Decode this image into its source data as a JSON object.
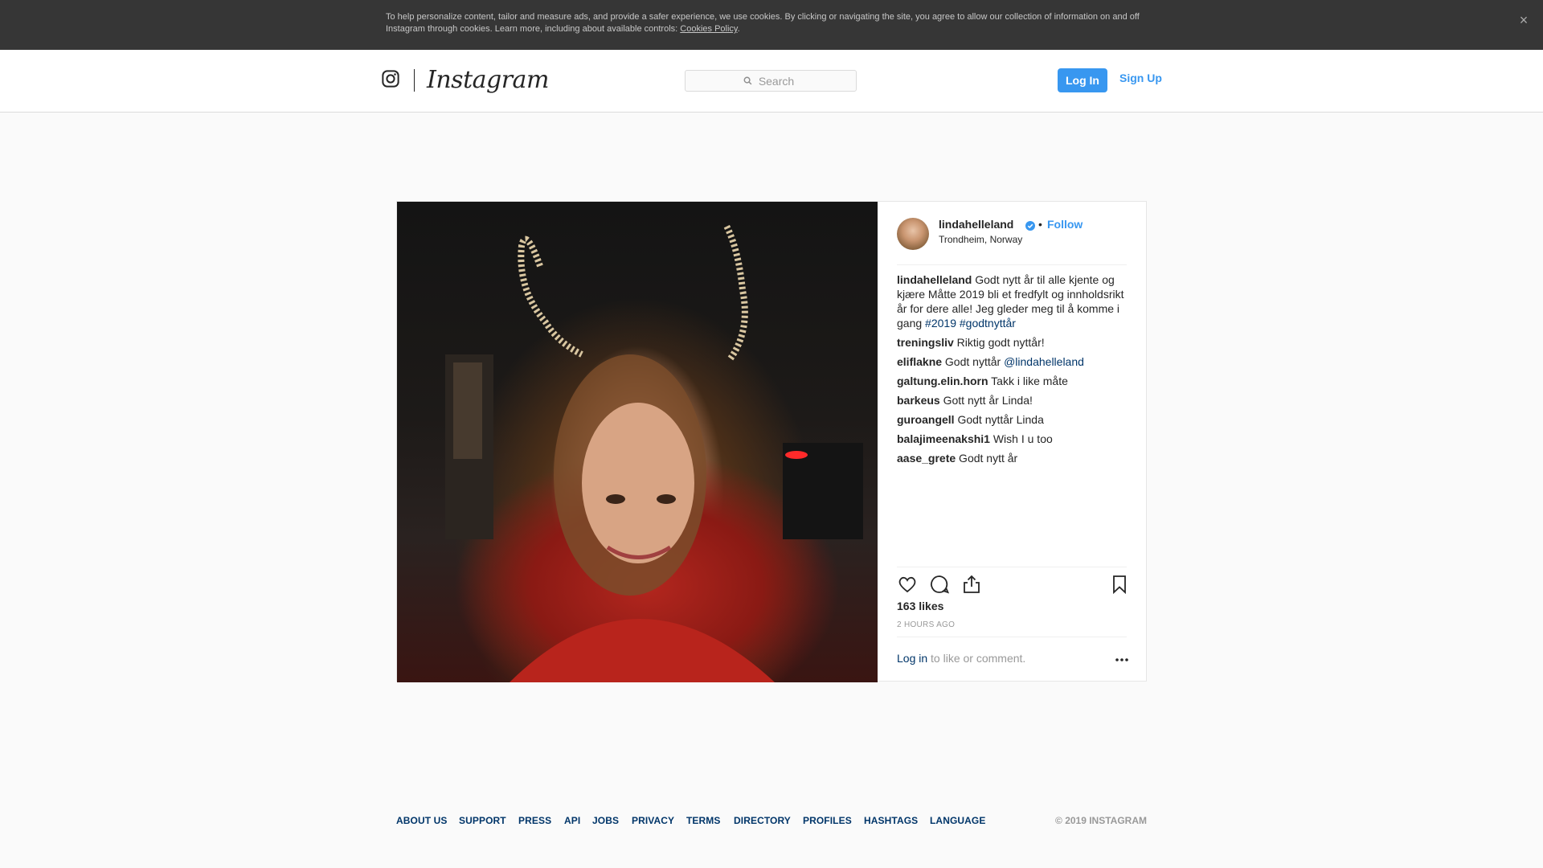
{
  "cookie_banner": {
    "text": "To help personalize content, tailor and measure ads, and provide a safer experience, we use cookies. By clicking or navigating the site, you agree to allow our collection of information on and off Instagram through cookies. Learn more, including about available controls: ",
    "link": "Cookies Policy",
    "trailing": ".",
    "close": "×"
  },
  "header": {
    "logo": "Instagram",
    "search_placeholder": "Search",
    "login": "Log In",
    "signup": "Sign Up"
  },
  "post": {
    "username": "lindahelleland",
    "dot": "•",
    "follow": "Follow",
    "location": "Trondheim, Norway",
    "caption": {
      "user": "lindahelleland",
      "text": " Godt nytt år til alle kjente og kjære  Måtte 2019 bli et fredfylt og innholdsrikt år for dere alle! Jeg gleder meg til å komme i gang  ",
      "tag1": "#2019",
      "tag2": "#godtnyttår"
    },
    "comments": [
      {
        "user": "treningsliv",
        "text": " Riktig godt nyttår! "
      },
      {
        "user": "eliflakne",
        "text": " Godt nyttår ",
        "mention": "@lindahelleland"
      },
      {
        "user": "galtung.elin.horn",
        "text": " Takk i like måte "
      },
      {
        "user": "barkeus",
        "text": " Gott nytt år Linda! "
      },
      {
        "user": "guroangell",
        "text": " Godt nyttår Linda"
      },
      {
        "user": "balajimeenakshi1",
        "text": " Wish I u too"
      },
      {
        "user": "aase_grete",
        "text": " Godt nytt år "
      }
    ],
    "likes": "163 likes",
    "time_ago": "2 HOURS AGO",
    "login_link": "Log in",
    "login_text": " to like or comment."
  },
  "footer": {
    "links": [
      "ABOUT US",
      "SUPPORT",
      "PRESS",
      "API",
      "JOBS",
      "PRIVACY",
      "TERMS",
      "DIRECTORY",
      "PROFILES",
      "HASHTAGS",
      "LANGUAGE"
    ],
    "copyright": "© 2019 INSTAGRAM"
  },
  "colors": {
    "accent": "#3897f0",
    "link": "#003569",
    "banner": "#363636"
  }
}
